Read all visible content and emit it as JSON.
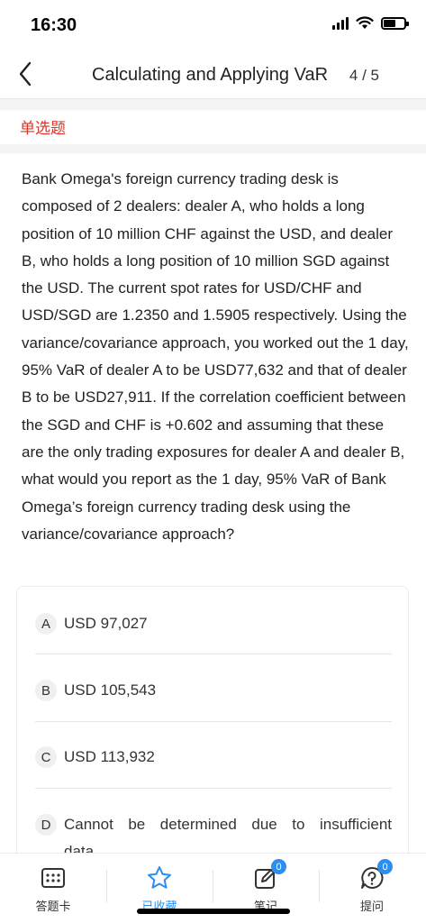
{
  "status_bar": {
    "time": "16:30"
  },
  "nav": {
    "title": "Calculating and Applying VaR",
    "progress": "4 / 5"
  },
  "question": {
    "type_label": "单选题",
    "text": "Bank Omega's foreign currency trading desk is composed of 2 dealers: dealer A, who holds a long position of 10 million CHF against the USD, and dealer B, who holds a long position of 10 million SGD against the USD. The current spot rates for USD/CHF and USD/SGD are 1.2350 and 1.5905 respectively. Using the variance/covariance approach, you worked out the 1 day, 95% VaR of dealer A to be USD77,632 and that of dealer B to be USD27,911. If the correlation coefficient between the SGD and CHF is +0.602 and assuming that these are the only trading exposures for dealer A and dealer B, what would you report as the 1 day, 95% VaR of Bank Omega’s foreign currency trading desk using the variance/covariance approach?"
  },
  "options": [
    {
      "letter": "A",
      "text": "USD 97,027"
    },
    {
      "letter": "B",
      "text": "USD 105,543"
    },
    {
      "letter": "C",
      "text": "USD 113,932"
    },
    {
      "letter": "D",
      "text": "Cannot be determined due to insufficient",
      "text_line2": "data"
    }
  ],
  "tabs": [
    {
      "label": "答题卡",
      "icon": "answer-card-icon"
    },
    {
      "label": "已收藏",
      "icon": "star-icon",
      "active": true
    },
    {
      "label": "笔记",
      "icon": "note-icon",
      "badge": "0"
    },
    {
      "label": "提问",
      "icon": "question-icon",
      "badge": "0"
    }
  ],
  "colors": {
    "accent": "#2b8ef0",
    "question_type": "#d9352b"
  }
}
